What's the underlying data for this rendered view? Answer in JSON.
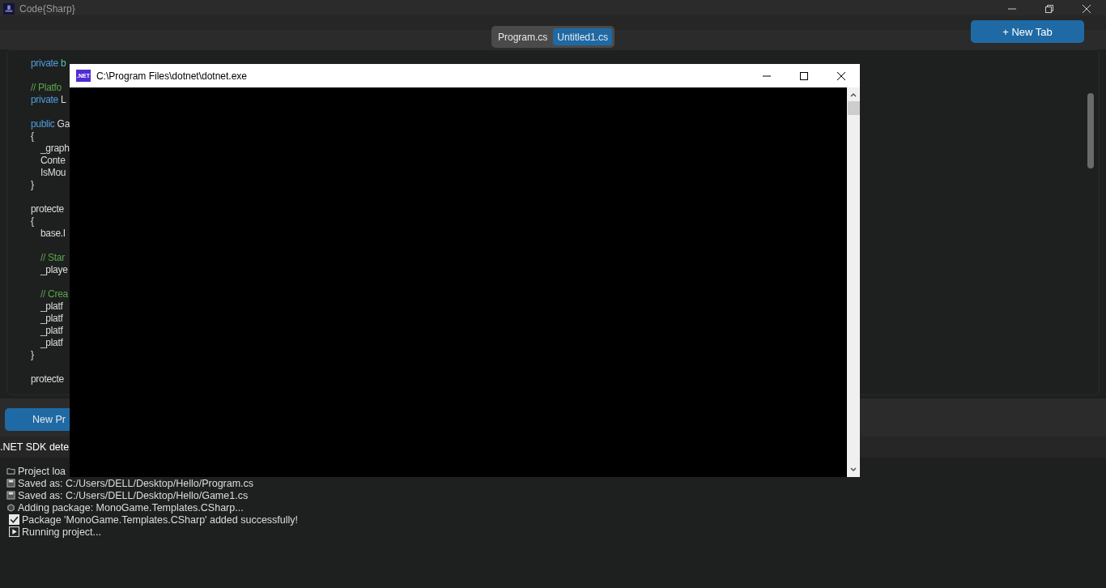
{
  "app": {
    "title": "Code{Sharp}"
  },
  "file_tabs": [
    {
      "label": "Program.cs",
      "selected": false
    },
    {
      "label": "Untitled1.cs",
      "selected": true
    }
  ],
  "new_tab_button": "+ New Tab",
  "code_lines": [
    {
      "kind": "code",
      "tokens": [
        {
          "text": "private",
          "kind": "keyword"
        },
        {
          "text": "b",
          "kind": "type"
        }
      ]
    },
    {
      "kind": "blank"
    },
    {
      "kind": "code",
      "tokens": [
        {
          "text": "// Platfo",
          "kind": "comment"
        }
      ]
    },
    {
      "kind": "code",
      "tokens": [
        {
          "text": "private",
          "kind": "keyword"
        },
        {
          "text": "L",
          "kind": "plain"
        }
      ]
    },
    {
      "kind": "blank"
    },
    {
      "kind": "code",
      "tokens": [
        {
          "text": "public",
          "kind": "keyword"
        },
        {
          "text": "Ga",
          "kind": "plain"
        }
      ]
    },
    {
      "kind": "code",
      "tokens": [
        {
          "text": "{",
          "kind": "plain"
        }
      ],
      "children": [
        {
          "kind": "code",
          "tokens": [
            {
              "text": "_graph",
              "kind": "plain"
            }
          ]
        },
        {
          "kind": "code",
          "tokens": [
            {
              "text": "Conte",
              "kind": "plain"
            }
          ]
        },
        {
          "kind": "code",
          "tokens": [
            {
              "text": "IsMou",
              "kind": "plain"
            }
          ]
        }
      ]
    },
    {
      "kind": "code",
      "tokens": [
        {
          "text": "}",
          "kind": "plain"
        }
      ]
    },
    {
      "kind": "blank"
    },
    {
      "kind": "code",
      "tokens": [
        {
          "text": "protecte",
          "kind": "plain"
        }
      ]
    },
    {
      "kind": "code",
      "tokens": [
        {
          "text": "{",
          "kind": "plain"
        }
      ],
      "children": [
        {
          "kind": "code",
          "tokens": [
            {
              "text": "base.I",
              "kind": "plain"
            }
          ]
        },
        {
          "kind": "blank"
        },
        {
          "kind": "code",
          "tokens": [
            {
              "text": "// Star",
              "kind": "comment"
            }
          ]
        },
        {
          "kind": "code",
          "tokens": [
            {
              "text": "_playe",
              "kind": "plain"
            }
          ]
        },
        {
          "kind": "blank"
        },
        {
          "kind": "code",
          "tokens": [
            {
              "text": "// Crea",
              "kind": "comment"
            }
          ]
        },
        {
          "kind": "code",
          "tokens": [
            {
              "text": "_platf",
              "kind": "plain"
            }
          ]
        },
        {
          "kind": "code",
          "tokens": [
            {
              "text": "_platf",
              "kind": "plain"
            }
          ]
        },
        {
          "kind": "code",
          "tokens": [
            {
              "text": "_platf",
              "kind": "plain"
            }
          ]
        },
        {
          "kind": "code",
          "tokens": [
            {
              "text": "_platf",
              "kind": "plain"
            }
          ]
        }
      ]
    },
    {
      "kind": "code",
      "tokens": [
        {
          "text": "}",
          "kind": "plain"
        }
      ]
    },
    {
      "kind": "blank"
    },
    {
      "kind": "code",
      "tokens": [
        {
          "text": "protecte",
          "kind": "plain"
        }
      ]
    }
  ],
  "new_project_button": "New Pr",
  "sdk_status": ".NET SDK dete",
  "log": [
    {
      "kind": "folder",
      "text": "Project loa"
    },
    {
      "kind": "floppy",
      "text": "Saved as: C:/Users/DELL/Desktop/Hello/Program.cs"
    },
    {
      "kind": "floppy",
      "text": "Saved as: C:/Users/DELL/Desktop/Hello/Game1.cs"
    },
    {
      "kind": "package",
      "text": "Adding package: MonoGame.Templates.CSharp..."
    },
    {
      "kind": "check",
      "text": "Package 'MonoGame.Templates.CSharp' added successfully!"
    },
    {
      "kind": "play",
      "text": "Running project..."
    }
  ],
  "console": {
    "badge": ".NET",
    "title": "C:\\Program Files\\dotnet\\dotnet.exe"
  }
}
